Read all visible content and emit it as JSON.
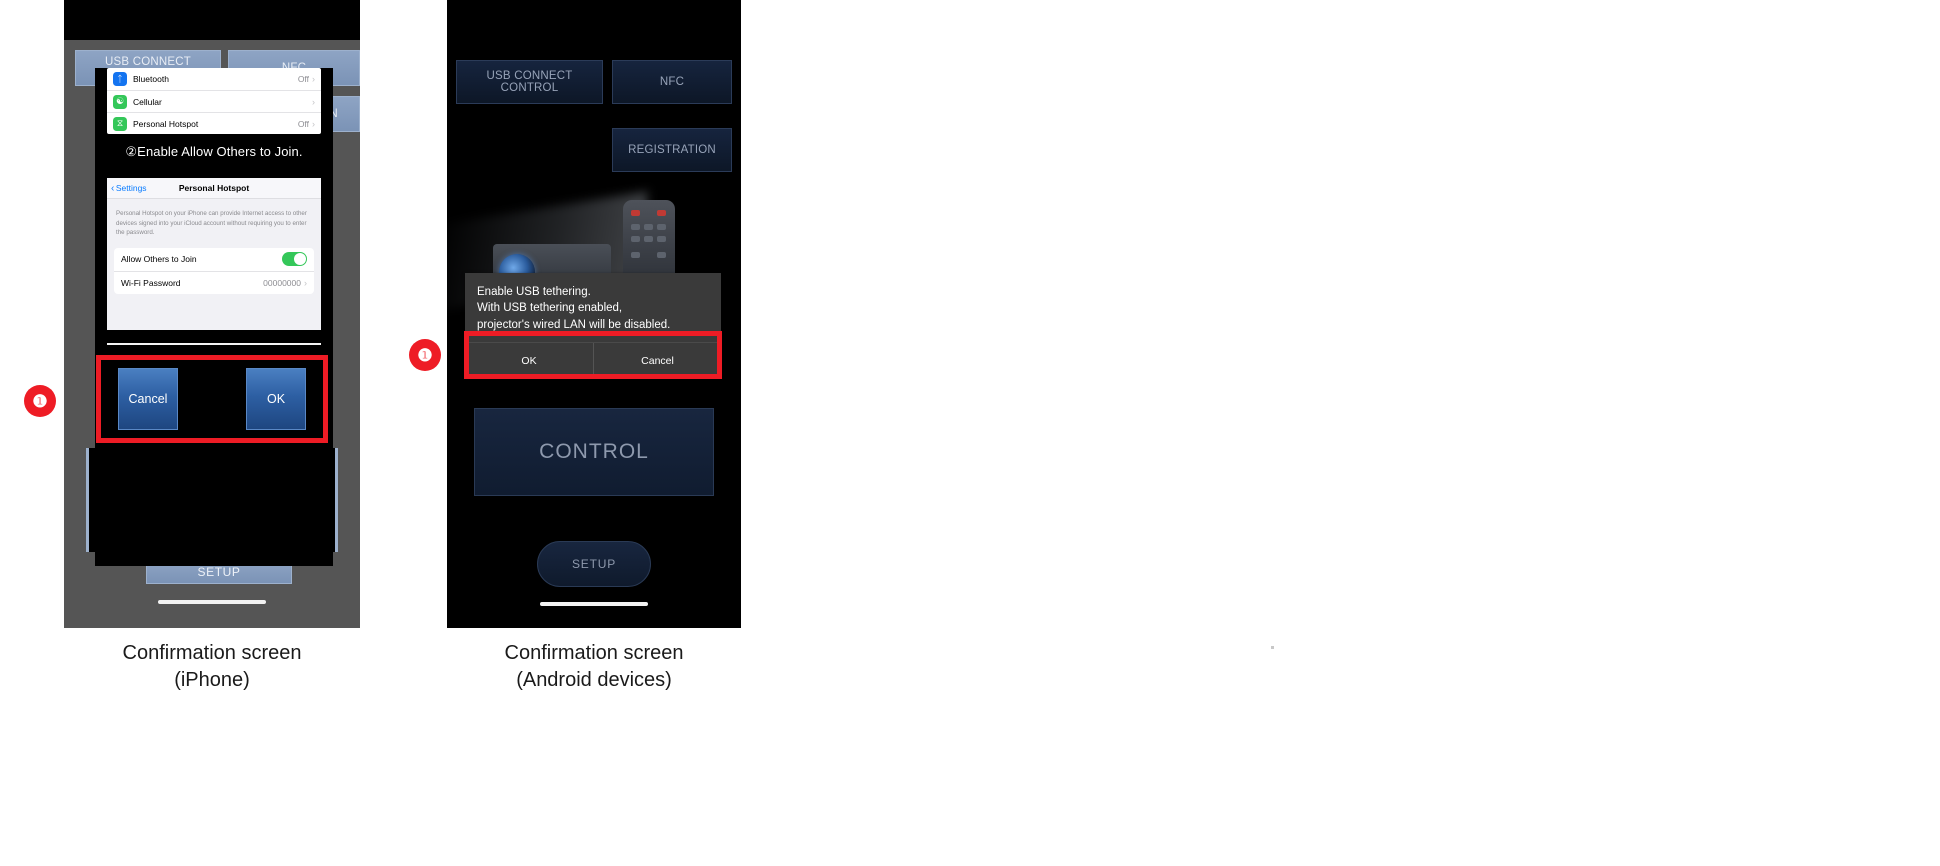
{
  "page": {
    "background": "#ffffff",
    "accent_red": "#ee1c25"
  },
  "iphone_panel": {
    "caption": "Confirmation screen\n(iPhone)",
    "badge": "❶",
    "app_buttons": [
      {
        "name": "usb-connect-control",
        "label": "USB CONNECT CONTROL"
      },
      {
        "name": "nfc",
        "label": "NFC"
      },
      {
        "name": "registration",
        "label": "REGISTRATION"
      }
    ],
    "setup_label": "SETUP",
    "ios_settings": {
      "rows": [
        {
          "icon": "bluetooth-icon",
          "label": "Bluetooth",
          "value": "Off",
          "chevron": "›"
        },
        {
          "icon": "cellular-icon",
          "label": "Cellular",
          "value": "",
          "chevron": "›"
        },
        {
          "icon": "personal-hotspot-icon",
          "label": "Personal Hotspot",
          "value": "Off",
          "chevron": "›"
        }
      ],
      "step_caption": "②Enable Allow Others to Join.",
      "nav_back": "Settings",
      "nav_back_chevron": "‹",
      "nav_title": "Personal Hotspot",
      "description": "Personal Hotspot on your iPhone can provide Internet access to other devices signed into your iCloud account without requiring you to enter the password.",
      "detail_rows": [
        {
          "label": "Allow Others to Join",
          "control": "toggle-on"
        },
        {
          "label": "Wi-Fi Password",
          "value": "00000000",
          "chevron": "›"
        }
      ]
    },
    "dialog_buttons": [
      {
        "name": "cancel",
        "label": "Cancel"
      },
      {
        "name": "ok",
        "label": "OK"
      }
    ]
  },
  "android_panel": {
    "caption": "Confirmation screen\n(Android devices)",
    "badge": "❶",
    "app_buttons": [
      {
        "name": "usb-connect-control",
        "label": "USB CONNECT CONTROL"
      },
      {
        "name": "nfc",
        "label": "NFC"
      },
      {
        "name": "registration",
        "label": "REGISTRATION"
      }
    ],
    "control_label": "CONTROL",
    "setup_label": "SETUP",
    "dialog": {
      "message": "Enable USB tethering.\nWith USB tethering enabled,\nprojector's wired LAN will be disabled.",
      "buttons": [
        {
          "name": "ok",
          "label": "OK"
        },
        {
          "name": "cancel",
          "label": "Cancel"
        }
      ]
    }
  }
}
